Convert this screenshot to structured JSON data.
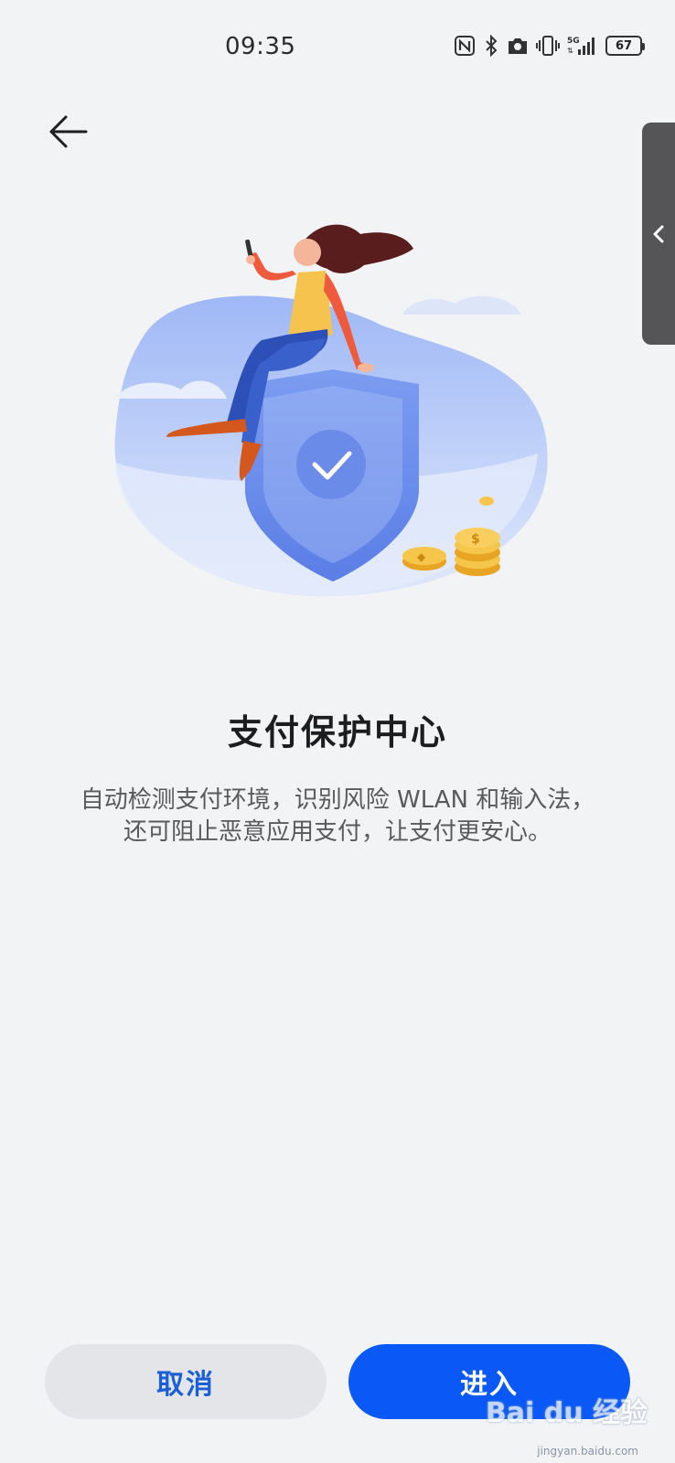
{
  "status_bar": {
    "time": "09:35",
    "battery_level": "67",
    "icons": [
      "nfc-icon",
      "bluetooth-icon",
      "camera-icon",
      "vibrate-icon",
      "signal-5g-icon",
      "battery-icon"
    ]
  },
  "header": {
    "back_icon": "arrow-left-icon"
  },
  "side_handle": {
    "icon": "chevron-left-icon"
  },
  "main": {
    "title": "支付保护中心",
    "description_line1": "自动检测支付环境，识别风险 WLAN 和输入法，",
    "description_line2": "还可阻止恶意应用支付，让支付更安心。"
  },
  "actions": {
    "cancel_label": "取消",
    "enter_label": "进入"
  },
  "watermark": {
    "text": "Bai du 经验",
    "sub": "jingyan.baidu.com"
  },
  "colors": {
    "primary": "#0a59f7",
    "cancel_bg": "#e3e5e8",
    "cancel_text": "#1a5fd6",
    "background": "#f1f3f5"
  }
}
